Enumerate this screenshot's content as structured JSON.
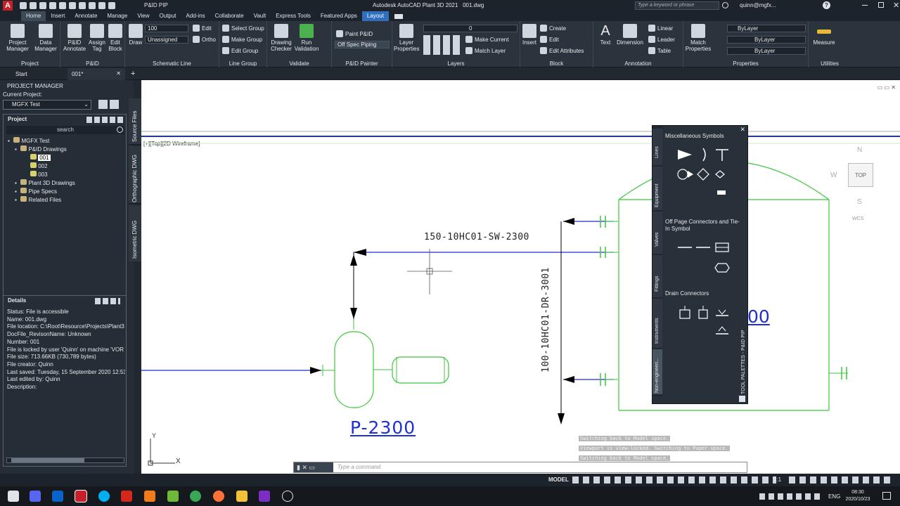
{
  "window": {
    "app_title": "Autodesk AutoCAD Plant 3D 2021",
    "file": "001.dwg",
    "workspace": "P&ID PIP",
    "search_placeholder": "Type a keyword or phrase",
    "user": "quinn@mgfx..."
  },
  "ribbon_tabs": [
    "Home",
    "Insert",
    "Annotate",
    "Manage",
    "View",
    "Output",
    "Add-ins",
    "Collaborate",
    "Vault",
    "Express Tools",
    "Featured Apps",
    "Layout"
  ],
  "ribbon": {
    "project_manager": "Project Manager",
    "data_manager": "Data Manager",
    "pid_annotate": "P&ID Annotate",
    "assign_tag": "Assign Tag",
    "edit_block": "Edit Block",
    "draw": "Draw",
    "edit": "Edit",
    "ortho": "Ortho",
    "line_size": "100",
    "line_spec": "Unassigned",
    "select_group": "Select Group",
    "make_group": "Make Group",
    "edit_group": "Edit Group",
    "drawing_checker": "Drawing Checker",
    "run_validation": "Run Validation",
    "paint_pid": "Paint P&ID",
    "off_spec_piping": "Off Spec Piping",
    "layer_properties": "Layer Properties",
    "layer_current": "0",
    "make_current": "Make Current",
    "match_layer": "Match Layer",
    "insert": "Insert",
    "block_create": "Create",
    "block_edit": "Edit",
    "edit_attributes": "Edit Attributes",
    "text": "Text",
    "dimension": "Dimension",
    "linear": "Linear",
    "leader": "Leader",
    "table": "Table",
    "match_properties": "Match Properties",
    "bylayer_color": "ByLayer",
    "bylayer_lt": "ByLayer",
    "bylayer_lw": "ByLayer",
    "measure": "Measure",
    "panel_titles": {
      "project": "Project",
      "pid": "P&ID",
      "schematic_line": "Schematic Line",
      "line_group": "Line Group",
      "validate": "Validate",
      "pid_painter": "P&ID Painter",
      "layers": "Layers",
      "block": "Block",
      "annotation": "Annotation",
      "properties": "Properties",
      "utilities": "Utilities"
    }
  },
  "doc_tabs": [
    "Start",
    "001*"
  ],
  "project_manager": {
    "title": "PROJECT MANAGER",
    "current_project_label": "Current Project:",
    "current_project": "MGFX Test",
    "project_header": "Project",
    "search": "search",
    "tree": {
      "root": "MGFX Test",
      "pid_drawings": "P&ID Drawings",
      "drawings": [
        "001",
        "002",
        "003"
      ],
      "plant3d": "Plant 3D Drawings",
      "pipe_specs": "Pipe Specs",
      "related_files": "Related Files"
    },
    "details_header": "Details",
    "details": [
      "Status: File is accessible",
      "Name: 001.dwg",
      "File location: C:\\Root\\Resource\\Projects\\Plant3",
      "DocFile_RevisonName:  Unknown",
      "Number: 001",
      "File is locked by user 'Quinn' on machine 'VOR",
      "File size: 713.66KB (730,789 bytes)",
      "File creator: Quinn",
      "Last saved: Tuesday, 15 September 2020 12:53:",
      "Last edited by: Quinn",
      "Description:"
    ],
    "vertical_tabs": [
      "Source Files",
      "Orthographic DWG",
      "Isometric DWG"
    ]
  },
  "canvas": {
    "viewport_label": "[+][Top][2D Wireframe]",
    "line_tag_horizontal": "150-10HC01-SW-2300",
    "line_tag_vertical": "100-10HC01-DR-3001",
    "pump_tag": "P-2300",
    "vessel_tag_partial": "00",
    "viewcube": {
      "n": "N",
      "w": "W",
      "s": "S",
      "top": "TOP",
      "wcs": "WCS"
    },
    "ucs": {
      "x": "X",
      "y": "Y"
    },
    "command_history": [
      "Switching back to Model space.",
      "Viewport is view-locked. Switching to Paper space.",
      "Switching back to Model space."
    ],
    "command_placeholder": "Type a command"
  },
  "palette": {
    "title": "TOOL PALETTES - P&ID PIP",
    "side_tabs": [
      "Lines",
      "Equipment",
      "Valves",
      "Fittings",
      "Instruments",
      "Non-engineeri..."
    ],
    "sections": [
      "Miscellaneous Symbols",
      "Off Page Connectors and Tie-In Symbol",
      "Drain Connectors"
    ]
  },
  "statusbar": {
    "model": "MODEL",
    "scale": "1:1"
  },
  "taskbar": {
    "lang": "ENG",
    "time": "08:30",
    "date": "2020/10/23"
  },
  "colors": {
    "pipe_blue": "#1e2fd6",
    "equip_green": "#3ec63a",
    "ribbon_bg": "#2b333d",
    "accent": "#2f6fbd"
  }
}
